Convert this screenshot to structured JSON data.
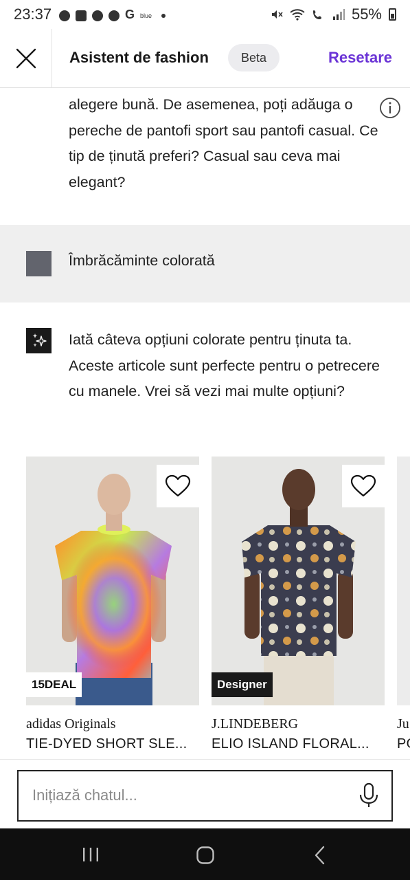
{
  "status_bar": {
    "time": "23:37",
    "carrier_label": "blue",
    "battery": "55%"
  },
  "header": {
    "title": "Asistent de fashion",
    "badge": "Beta",
    "reset_label": "Resetare",
    "accent_color": "#6b34d6"
  },
  "chat": {
    "assistant_message_1_partial": "alegere bună. De asemenea, poți adăuga o pereche de pantofi sport sau pantofi casual. Ce tip de ținută preferi? Casual sau ceva mai elegant?",
    "user_message": "Îmbrăcăminte colorată",
    "assistant_message_2": "Iată câteva opțiuni colorate pentru ținuta ta. Aceste articole sunt perfecte pentru o petrecere cu manele. Vrei să vezi mai multe opțiuni?"
  },
  "products": [
    {
      "brand": "adidas Originals",
      "name": "TIE-DYED SHORT SLE...",
      "badge": "15DEAL"
    },
    {
      "brand": "J.LINDEBERG",
      "name": "ELIO ISLAND FLORAL...",
      "badge": "Designer"
    },
    {
      "brand": "Ju",
      "name": "PO",
      "badge": ""
    }
  ],
  "input": {
    "placeholder": "Inițiază chatul..."
  },
  "icons": [
    "close-icon",
    "info-icon",
    "sparkle-icon",
    "heart-icon",
    "microphone-icon",
    "recent-apps-icon",
    "home-icon",
    "back-icon"
  ]
}
